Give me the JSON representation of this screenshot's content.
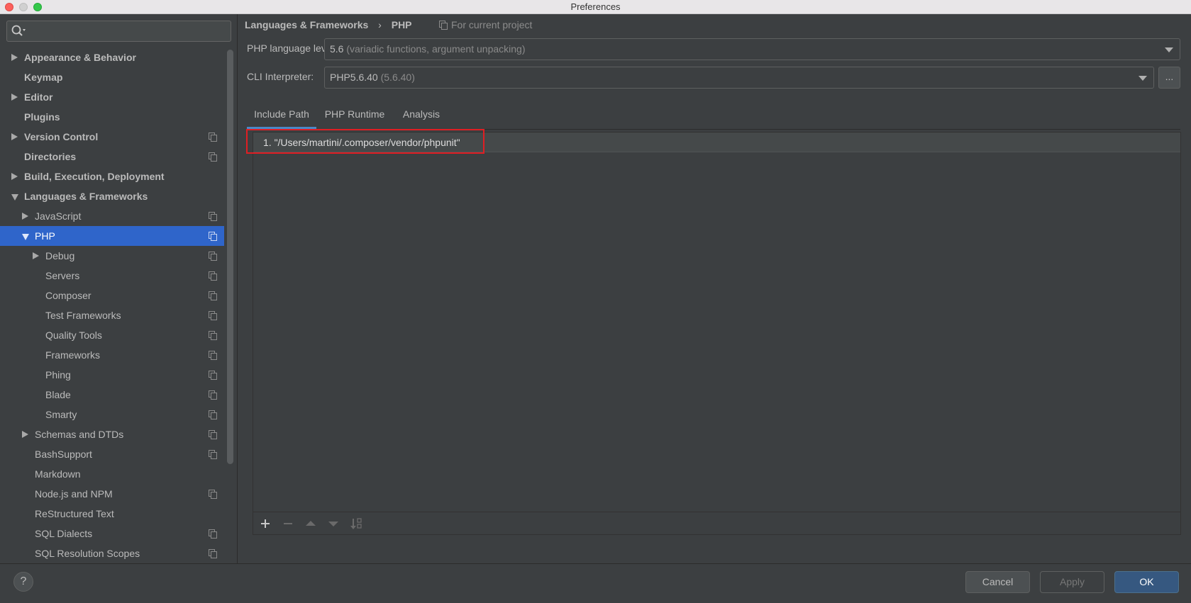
{
  "window": {
    "title": "Preferences"
  },
  "search": {
    "placeholder": ""
  },
  "sidebar": {
    "items": [
      {
        "label": "Appearance & Behavior",
        "arrow": "right",
        "bold": true,
        "copy": false
      },
      {
        "label": "Keymap",
        "arrow": "",
        "bold": true,
        "copy": false
      },
      {
        "label": "Editor",
        "arrow": "right",
        "bold": true,
        "copy": false
      },
      {
        "label": "Plugins",
        "arrow": "",
        "bold": true,
        "copy": false
      },
      {
        "label": "Version Control",
        "arrow": "right",
        "bold": true,
        "copy": true
      },
      {
        "label": "Directories",
        "arrow": "",
        "bold": true,
        "copy": true
      },
      {
        "label": "Build, Execution, Deployment",
        "arrow": "right",
        "bold": true,
        "copy": false
      },
      {
        "label": "Languages & Frameworks",
        "arrow": "down",
        "bold": true,
        "copy": false
      },
      {
        "label": "JavaScript",
        "arrow": "right",
        "bold": false,
        "copy": true
      },
      {
        "label": "PHP",
        "arrow": "down",
        "bold": false,
        "copy": true,
        "selected": true
      },
      {
        "label": "Debug",
        "arrow": "right",
        "bold": false,
        "copy": true
      },
      {
        "label": "Servers",
        "arrow": "",
        "bold": false,
        "copy": true
      },
      {
        "label": "Composer",
        "arrow": "",
        "bold": false,
        "copy": true
      },
      {
        "label": "Test Frameworks",
        "arrow": "",
        "bold": false,
        "copy": true
      },
      {
        "label": "Quality Tools",
        "arrow": "",
        "bold": false,
        "copy": true
      },
      {
        "label": "Frameworks",
        "arrow": "",
        "bold": false,
        "copy": true
      },
      {
        "label": "Phing",
        "arrow": "",
        "bold": false,
        "copy": true
      },
      {
        "label": "Blade",
        "arrow": "",
        "bold": false,
        "copy": true
      },
      {
        "label": "Smarty",
        "arrow": "",
        "bold": false,
        "copy": true
      },
      {
        "label": "Schemas and DTDs",
        "arrow": "right",
        "bold": false,
        "copy": true
      },
      {
        "label": "BashSupport",
        "arrow": "",
        "bold": false,
        "copy": true
      },
      {
        "label": "Markdown",
        "arrow": "",
        "bold": false,
        "copy": false
      },
      {
        "label": "Node.js and NPM",
        "arrow": "",
        "bold": false,
        "copy": true
      },
      {
        "label": "ReStructured Text",
        "arrow": "",
        "bold": false,
        "copy": false
      },
      {
        "label": "SQL Dialects",
        "arrow": "",
        "bold": false,
        "copy": true
      },
      {
        "label": "SQL Resolution Scopes",
        "arrow": "",
        "bold": false,
        "copy": true
      }
    ]
  },
  "breadcrumb": {
    "parent": "Languages & Frameworks",
    "separator": "›",
    "current": "PHP",
    "scope": "For current project"
  },
  "php_level": {
    "label": "PHP language level:",
    "value": "5.6",
    "detail": "(variadic functions, argument unpacking)"
  },
  "cli": {
    "label": "CLI Interpreter:",
    "value": "PHP5.6.40",
    "detail": "(5.6.40)",
    "more_label": "..."
  },
  "tabs": [
    {
      "label": "Include Path",
      "active": true
    },
    {
      "label": "PHP Runtime",
      "active": false
    },
    {
      "label": "Analysis",
      "active": false
    }
  ],
  "include_paths": [
    "1. \"/Users/martini/.composer/vendor/phpunit\""
  ],
  "toolbar": {
    "icons": [
      "add-icon",
      "remove-icon",
      "move-up-icon",
      "move-down-icon",
      "sort-icon"
    ]
  },
  "footer": {
    "help_label": "?",
    "cancel_label": "Cancel",
    "apply_label": "Apply",
    "ok_label": "OK"
  },
  "colors": {
    "selection": "#2f65ca",
    "tab_underline": "#4a88c7",
    "highlight_box": "#e01e23",
    "ok_button": "#365880"
  }
}
